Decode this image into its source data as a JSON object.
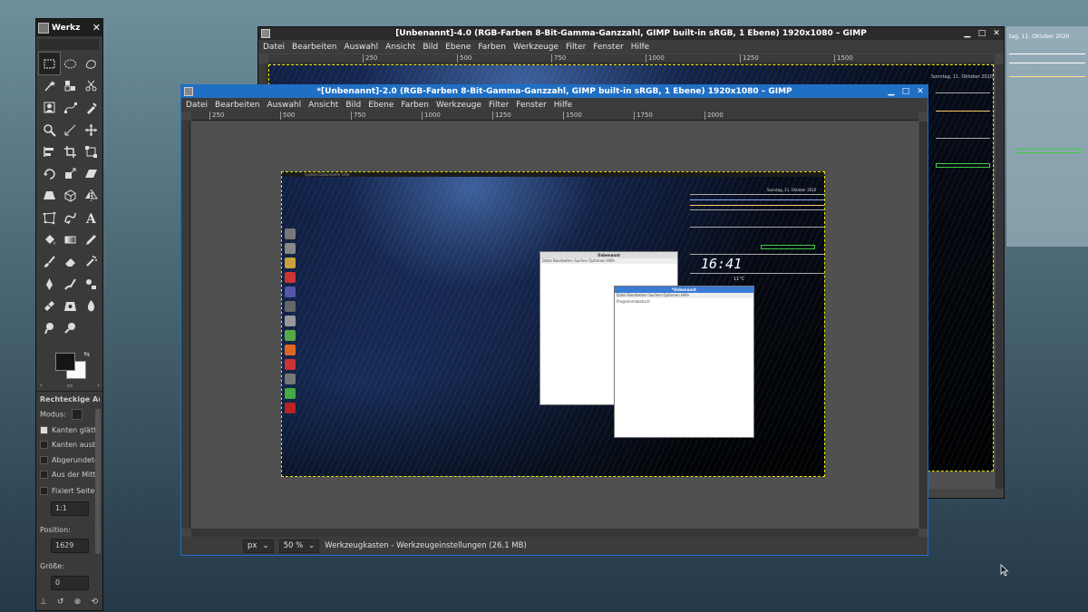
{
  "toolbox": {
    "title": "Werkzeugkasten",
    "title_short": "Werkz",
    "tools": [
      "rect-select",
      "ellipse-select",
      "free-select",
      "fuzzy-select",
      "by-color-select",
      "scissors-select",
      "foreground-select",
      "paths",
      "color-picker",
      "zoom",
      "measure",
      "move",
      "align",
      "crop",
      "unified-transform",
      "rotate",
      "scale",
      "shear",
      "perspective",
      "3d-transform",
      "flip",
      "cage",
      "warp",
      "text",
      "bucket-fill",
      "gradient",
      "pencil",
      "paintbrush",
      "eraser",
      "airbrush",
      "ink",
      "mypaint-brush",
      "clone",
      "heal",
      "perspective-clone",
      "blur",
      "smudge",
      "dodge-burn",
      ""
    ],
    "options": {
      "heading": "Rechteckige Auswahl",
      "mode_label": "Modus:",
      "antialias": "Kanten glätten",
      "feather": "Kanten ausblenden",
      "rounded": "Abgerundete Ecken",
      "from_center": "Aus der Mitte aufziehen",
      "fixed": "Fixiert Seitenverhältnis",
      "ratio": "1:1",
      "position_label": "Position:",
      "position_value": "1629",
      "size_label": "Größe:",
      "size_value": "0"
    }
  },
  "back_window": {
    "title": "[Unbenannt]-4.0 (RGB-Farben 8-Bit-Gamma-Ganzzahl, GIMP built-in sRGB, 1 Ebene) 1920x1080 – GIMP",
    "ruler_ticks": [
      "250",
      "500",
      "750",
      "1000",
      "1250",
      "1500"
    ]
  },
  "front_window": {
    "title": "*[Unbenannt]-2.0 (RGB-Farben 8-Bit-Gamma-Ganzzahl, GIMP built-in sRGB, 1 Ebene) 1920x1080 – GIMP",
    "ruler_ticks": [
      "250",
      "500",
      "750",
      "1000",
      "1250",
      "1500",
      "1750",
      "2000"
    ],
    "unit": "px",
    "zoom": "50 %",
    "status": "Werkzeugkasten - Werkzeugeinstellungen (26.1 MB)"
  },
  "menu": [
    "Datei",
    "Bearbeiten",
    "Auswahl",
    "Ansicht",
    "Bild",
    "Ebene",
    "Farben",
    "Werkzeuge",
    "Filter",
    "Fenster",
    "Hilfe"
  ],
  "screenshot": {
    "clock": "16:41",
    "date": "Sonntag, 11. Oktober 2020",
    "date_partial": "tag, 11. Oktober 2020",
    "temp": "11°C",
    "mini_windows": [
      {
        "title": "Unbenannt",
        "menu": "Datei  Bearbeiten  Suchen  Optionen  Hilfe",
        "content": ""
      },
      {
        "title": "*Unbenannt",
        "menu": "Datei  Bearbeiten  Suchen  Optionen  Hilfe",
        "content": "Programmabsturz!"
      }
    ],
    "panel_text": "System  Dokumente  Orte"
  },
  "colors": {
    "titlebar_active": "#1f6fc4",
    "titlebar_inactive": "#2b2b2b",
    "selection": "#e8e000"
  }
}
